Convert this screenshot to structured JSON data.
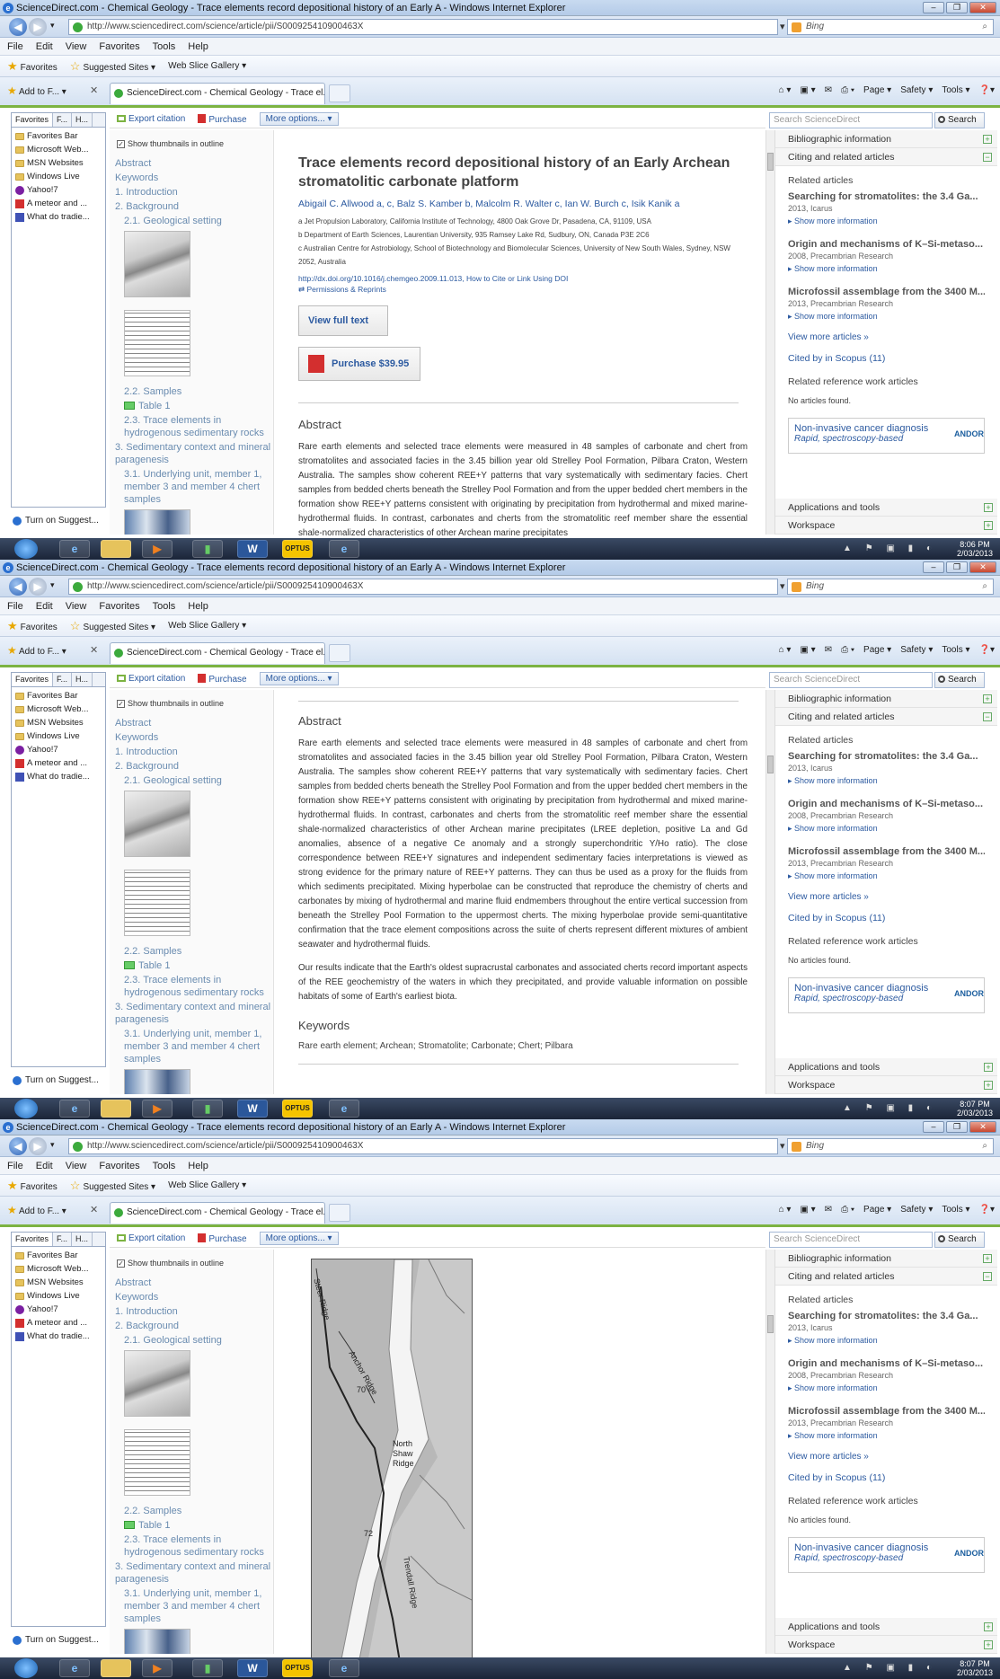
{
  "window": {
    "title": "ScienceDirect.com - Chemical Geology - Trace elements record depositional history of an Early A - Windows Internet Explorer",
    "url": "http://www.sciencedirect.com/science/article/pii/S000925410900463X",
    "search_provider": "Bing"
  },
  "menu": [
    "File",
    "Edit",
    "View",
    "Favorites",
    "Tools",
    "Help"
  ],
  "favbar": {
    "favorites": "Favorites",
    "suggested": "Suggested Sites ▾",
    "webslice": "Web Slice Gallery ▾"
  },
  "tabs": {
    "add_to": "Add to F...",
    "active_tab": "ScienceDirect.com - Chemical Geology - Trace el..."
  },
  "commandbar": [
    "Page ▾",
    "Safety ▾",
    "Tools ▾"
  ],
  "favpanel": {
    "tabs": [
      "Favorites",
      "F...",
      "H..."
    ],
    "items": [
      "Favorites Bar",
      "Microsoft Web...",
      "MSN Websites",
      "Windows Live",
      "Yahoo!7",
      "A meteor and ...",
      "What do tradie..."
    ],
    "turn_on": "Turn on Suggest..."
  },
  "toolbar": {
    "export": "Export citation",
    "purchase": "Purchase",
    "more": "More options... ▾"
  },
  "search": {
    "placeholder": "Search ScienceDirect",
    "button": "Search"
  },
  "outline": {
    "show_thumbs": "Show thumbnails in outline",
    "abstract": "Abstract",
    "keywords": "Keywords",
    "intro": "1. Introduction",
    "background": "2. Background",
    "geo_setting": "2.1. Geological setting",
    "samples": "2.2. Samples",
    "table1": "Table 1",
    "trace1": "2.3. Trace elements in",
    "trace2": "hydrogenous sedimentary rocks",
    "sed1": "3. Sedimentary context and mineral",
    "sed2": "paragenesis",
    "under1": "3.1. Underlying unit, member 1,",
    "under2": "member 3 and member 4 chert",
    "under3": "samples"
  },
  "article": {
    "title": "Trace elements record depositional history of an Early Archean stromatolitic carbonate platform",
    "authors": "Abigail C. Allwood a, c, Balz S. Kamber b, Malcolm R. Walter c, Ian W. Burch c, Isik Kanik a",
    "affil_a": "a Jet Propulsion Laboratory, California Institute of Technology, 4800 Oak Grove Dr, Pasadena, CA, 91109, USA",
    "affil_b": "b Department of Earth Sciences, Laurentian University, 935 Ramsey Lake Rd, Sudbury, ON, Canada P3E 2C6",
    "affil_c": "c Australian Centre for Astrobiology, School of Biotechnology and Biomolecular Sciences, University of New South Wales, Sydney, NSW 2052, Australia",
    "doi": "http://dx.doi.org/10.1016/j.chemgeo.2009.11.013, How to Cite or Link Using DOI",
    "permissions": "Permissions & Reprints",
    "view_full": "View full text",
    "purchase": "Purchase $39.95",
    "abstract_heading": "Abstract",
    "abstract_short": "Rare earth elements and selected trace elements were measured in 48 samples of carbonate and chert from stromatolites and associated facies in the 3.45 billion year old Strelley Pool Formation, Pilbara Craton, Western Australia. The samples show coherent REE+Y patterns that vary systematically with sedimentary facies. Chert samples from bedded cherts beneath the Strelley Pool Formation and from the upper bedded chert members in the formation show REE+Y patterns consistent with originating by precipitation from hydrothermal and mixed marine-hydrothermal fluids. In contrast, carbonates and cherts from the stromatolitic reef member share the essential shale-normalized characteristics of other Archean marine precipitates",
    "abstract_full": "Rare earth elements and selected trace elements were measured in 48 samples of carbonate and chert from stromatolites and associated facies in the 3.45 billion year old Strelley Pool Formation, Pilbara Craton, Western Australia. The samples show coherent REE+Y patterns that vary systematically with sedimentary facies. Chert samples from bedded cherts beneath the Strelley Pool Formation and from the upper bedded chert members in the formation show REE+Y patterns consistent with originating by precipitation from hydrothermal and mixed marine-hydrothermal fluids. In contrast, carbonates and cherts from the stromatolitic reef member share the essential shale-normalized characteristics of other Archean marine precipitates (LREE depletion, positive La and Gd anomalies, absence of a negative Ce anomaly and a strongly superchondritic Y/Ho ratio). The close correspondence between REE+Y signatures and independent sedimentary facies interpretations is viewed as strong evidence for the primary nature of REE+Y patterns. They can thus be used as a proxy for the fluids from which sediments precipitated. Mixing hyperbolae can be constructed that reproduce the chemistry of cherts and carbonates by mixing of hydrothermal and marine fluid endmembers throughout the entire vertical succession from beneath the Strelley Pool Formation to the uppermost cherts. The mixing hyperbolae provide semi-quantitative confirmation that the trace element compositions across the suite of cherts represent different mixtures of ambient seawater and hydrothermal fluids.",
    "abstract_p2": "Our results indicate that the Earth's oldest supracrustal carbonates and associated cherts record important aspects of the REE geochemistry of the waters in which they precipitated, and provide valuable information on possible habitats of some of Earth's earliest biota.",
    "keywords_heading": "Keywords",
    "keywords": "Rare earth element; Archean; Stromatolite; Carbonate; Chert; Pilbara"
  },
  "map_labels": {
    "a": "Steer Ridge",
    "b": "Anchor Ridge",
    "c": "70",
    "d": "North Shaw Ridge",
    "e": "72",
    "f": "Trendall Ridge"
  },
  "rightpanel": {
    "biblio": "Bibliographic information",
    "citing": "Citing and related articles",
    "related_heading": "Related articles",
    "r1_title": "Searching for stromatolites: the 3.4 Ga...",
    "r1_meta": "2013, Icarus",
    "r2_title": "Origin and mechanisms of K–Si-metaso...",
    "r2_meta": "2008, Precambrian Research",
    "r3_title": "Microfossil assemblage from the 3400 M...",
    "r3_meta": "2013, Precambrian Research",
    "show_more": "Show more information",
    "view_more": "View more articles »",
    "cited": "Cited by in Scopus (11)",
    "refwork": "Related reference work articles",
    "noarticles": "No articles found.",
    "ad_title": "Non-invasive cancer diagnosis",
    "ad_sub": "Rapid, spectroscopy-based",
    "ad_logo": "ANDOR",
    "apps": "Applications and tools",
    "workspace": "Workspace"
  },
  "taskbar": {
    "w_label": "W",
    "optus_label": "OPTUS",
    "times": [
      "8:06 PM",
      "8:07 PM",
      "8:07 PM"
    ],
    "date": "2/03/2013"
  }
}
